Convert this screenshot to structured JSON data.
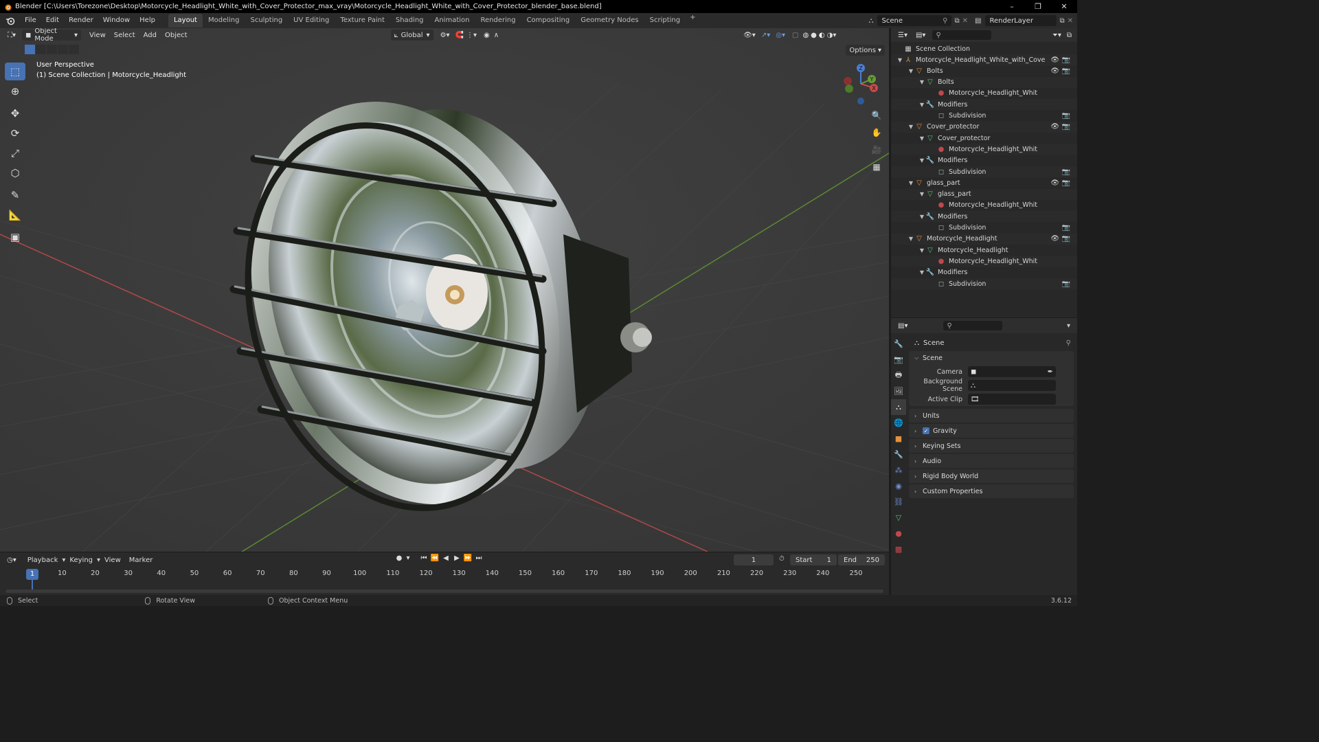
{
  "window": {
    "title": "Blender [C:\\Users\\Torezone\\Desktop\\Motorcycle_Headlight_White_with_Cover_Protector_max_vray\\Motorcycle_Headlight_White_with_Cover_Protector_blender_base.blend]",
    "controls": [
      "–",
      "❐",
      "✕"
    ]
  },
  "menubar": {
    "menus": [
      "File",
      "Edit",
      "Render",
      "Window",
      "Help"
    ],
    "workspaces": [
      "Layout",
      "Modeling",
      "Sculpting",
      "UV Editing",
      "Texture Paint",
      "Shading",
      "Animation",
      "Rendering",
      "Compositing",
      "Geometry Nodes",
      "Scripting"
    ],
    "active_workspace": "Layout",
    "add_tab": "+",
    "scene": "Scene",
    "view_layer": "RenderLayer"
  },
  "viewport": {
    "mode": "Object Mode",
    "menus": [
      "View",
      "Select",
      "Add",
      "Object"
    ],
    "orientation": "Global",
    "options": "Options",
    "overlay_line1": "User Perspective",
    "overlay_line2": "(1) Scene Collection | Motorcycle_Headlight",
    "gizmo_axes": {
      "x": "X",
      "y": "Y",
      "z": "Z"
    }
  },
  "tools": [
    "select-box",
    "cursor",
    "move",
    "rotate",
    "scale",
    "transform",
    "annotate",
    "measure",
    "add-cube"
  ],
  "timeline": {
    "menus": [
      "Playback",
      "Keying",
      "View",
      "Marker"
    ],
    "current_frame": "1",
    "start_label": "Start",
    "start": "1",
    "end_label": "End",
    "end": "250",
    "ticks": [
      "1",
      "10",
      "20",
      "30",
      "40",
      "50",
      "60",
      "70",
      "80",
      "90",
      "100",
      "110",
      "120",
      "130",
      "140",
      "150",
      "160",
      "170",
      "180",
      "190",
      "200",
      "210",
      "220",
      "230",
      "240",
      "250"
    ]
  },
  "statusbar": {
    "select": "Select",
    "rotate_view": "Rotate View",
    "context_menu": "Object Context Menu",
    "version": "3.6.12"
  },
  "outliner": {
    "root": "Scene Collection",
    "rows": [
      {
        "label": "Motorcycle_Headlight_White_with_Cove",
        "kind": "empty",
        "depth": 1,
        "vis": true
      },
      {
        "label": "Bolts",
        "kind": "object",
        "depth": 2,
        "vis": true
      },
      {
        "label": "Bolts",
        "kind": "mesh",
        "depth": 3,
        "vis": false
      },
      {
        "label": "Motorcycle_Headlight_Whit",
        "kind": "material",
        "depth": 4,
        "vis": false
      },
      {
        "label": "Modifiers",
        "kind": "modifiers",
        "depth": 3,
        "vis": false
      },
      {
        "label": "Subdivision",
        "kind": "subdivision",
        "depth": 4,
        "vis": false,
        "cam": true
      },
      {
        "label": "Cover_protector",
        "kind": "object",
        "depth": 2,
        "vis": true
      },
      {
        "label": "Cover_protector",
        "kind": "mesh",
        "depth": 3,
        "vis": false
      },
      {
        "label": "Motorcycle_Headlight_Whit",
        "kind": "material",
        "depth": 4,
        "vis": false
      },
      {
        "label": "Modifiers",
        "kind": "modifiers",
        "depth": 3,
        "vis": false
      },
      {
        "label": "Subdivision",
        "kind": "subdivision",
        "depth": 4,
        "vis": false,
        "cam": true
      },
      {
        "label": "glass_part",
        "kind": "object",
        "depth": 2,
        "vis": true
      },
      {
        "label": "glass_part",
        "kind": "mesh",
        "depth": 3,
        "vis": false
      },
      {
        "label": "Motorcycle_Headlight_Whit",
        "kind": "material",
        "depth": 4,
        "vis": false
      },
      {
        "label": "Modifiers",
        "kind": "modifiers",
        "depth": 3,
        "vis": false
      },
      {
        "label": "Subdivision",
        "kind": "subdivision",
        "depth": 4,
        "vis": false,
        "cam": true
      },
      {
        "label": "Motorcycle_Headlight",
        "kind": "object",
        "depth": 2,
        "vis": true
      },
      {
        "label": "Motorcycle_Headlight",
        "kind": "mesh",
        "depth": 3,
        "vis": false
      },
      {
        "label": "Motorcycle_Headlight_Whit",
        "kind": "material",
        "depth": 4,
        "vis": false
      },
      {
        "label": "Modifiers",
        "kind": "modifiers",
        "depth": 3,
        "vis": false
      },
      {
        "label": "Subdivision",
        "kind": "subdivision",
        "depth": 4,
        "vis": false,
        "cam": true
      }
    ]
  },
  "properties": {
    "context": "Scene",
    "section": "Scene",
    "fields": [
      {
        "label": "Camera",
        "value": ""
      },
      {
        "label": "Background Scene",
        "value": ""
      },
      {
        "label": "Active Clip",
        "value": ""
      }
    ],
    "panels": [
      "Units",
      "Gravity",
      "Keying Sets",
      "Audio",
      "Rigid Body World",
      "Custom Properties"
    ],
    "gravity_checked": true
  },
  "colors": {
    "accent": "#4772b3",
    "x_axis": "#c94a4a",
    "y_axis": "#6a9a3a",
    "object_icon": "#e3913a",
    "mesh_icon": "#55c17a",
    "material_icon": "#c0484c",
    "modifier_icon": "#6e8fd4"
  }
}
